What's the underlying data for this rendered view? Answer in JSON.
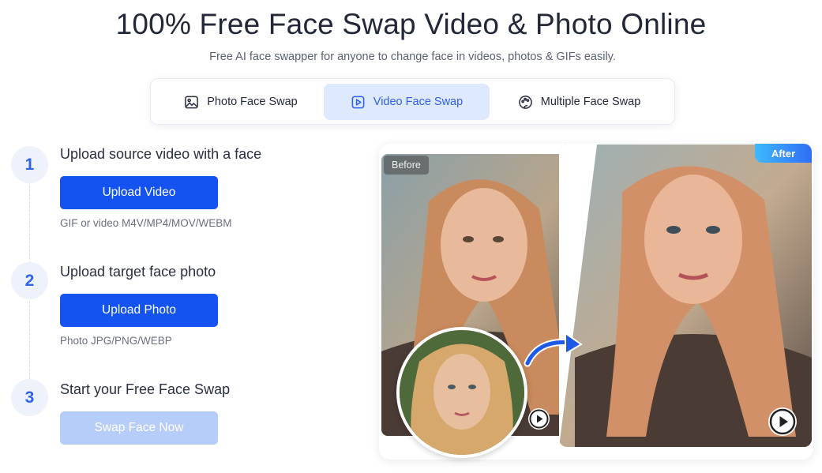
{
  "header": {
    "title": "100% Free Face Swap Video & Photo Online",
    "subtitle": "Free AI face swapper for anyone to change face in videos, photos & GIFs easily."
  },
  "tabs": [
    {
      "label": "Photo Face Swap",
      "icon": "image-icon",
      "active": false
    },
    {
      "label": "Video Face Swap",
      "icon": "video-play-icon",
      "active": true
    },
    {
      "label": "Multiple Face Swap",
      "icon": "palette-icon",
      "active": false
    }
  ],
  "steps": [
    {
      "number": "1",
      "title": "Upload source video with a face",
      "button": "Upload Video",
      "hint": "GIF or video M4V/MP4/MOV/WEBM"
    },
    {
      "number": "2",
      "title": "Upload target face photo",
      "button": "Upload Photo",
      "hint": "Photo JPG/PNG/WEBP"
    },
    {
      "number": "3",
      "title": "Start your Free Face Swap",
      "button": "Swap Face Now",
      "disabled": true
    }
  ],
  "preview": {
    "before_label": "Before",
    "after_label": "After"
  },
  "colors": {
    "primary": "#1453ef",
    "primary_disabled": "#b7cdf9",
    "active_tab_bg": "#dfe9fd",
    "active_tab_text": "#2d5ff0",
    "title_text": "#222838"
  }
}
